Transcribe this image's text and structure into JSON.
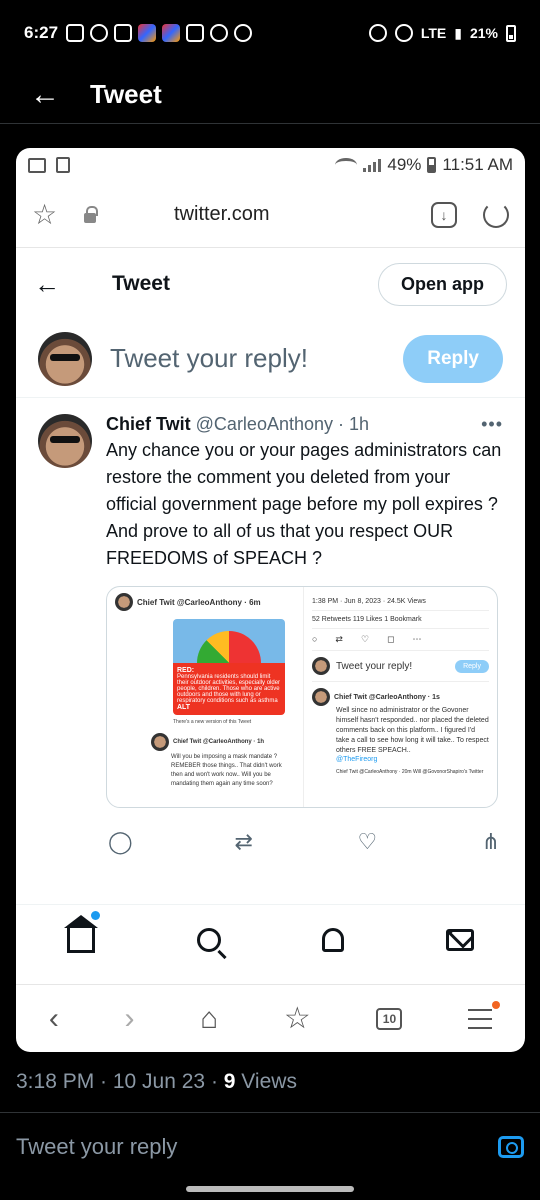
{
  "status_bar": {
    "time": "6:27",
    "battery": "21%",
    "network": "LTE"
  },
  "header": {
    "title": "Tweet"
  },
  "inner_status": {
    "battery": "49%",
    "time": "11:51 AM"
  },
  "browser": {
    "url": "twitter.com"
  },
  "twitter": {
    "title": "Tweet",
    "open_app": "Open app",
    "reply_placeholder": "Tweet your reply!",
    "reply_button": "Reply"
  },
  "tweet": {
    "name": "Chief Twit",
    "handle": "@CarleoAnthony · 1h",
    "more": "•••",
    "text": "Any chance you or your pages administrators can restore the comment you deleted from your official government page before my poll expires ?\nAnd prove to all of us that you respect OUR FREEDOMS of SPEACH ?"
  },
  "embed": {
    "left_head": "Chief Twit @CarleoAnthony · 6m",
    "alert_title": "RED:",
    "alert_body": "Pennsylvania residents should limit their outdoor activities, especially older people, children. Those who are active outdoors and those with lung or respiratory conditions such as asthma",
    "alt": "ALT",
    "new_version": "There's a new version of this Tweet",
    "reply_head": "Chief Twit @CarleoAnthony · 1h",
    "reply_text": "Will you be imposing a mask mandate ? REMEBER those things.. That didn't work then and won't work now.. Will you be mandating them again any time soon?",
    "meta": "1:38 PM · Jun 8, 2023 · 24.5K Views",
    "stats": "52 Retweets   119 Likes   1 Bookmark",
    "mini_reply": "Tweet your reply!",
    "mini_reply_btn": "Reply",
    "right_head": "Chief Twit @CarleoAnthony · 1s",
    "right_text": "Well since no administrator or the Govoner himself hasn't responded.. nor placed the deleted comments back on this platform.. I figured I'd take a call to see how long it will take.. To respect others FREE SPEACH..",
    "right_link": "@TheFireorg",
    "right_sub": "Chief Twit @CarleoAnthony · 20m Will @GovonorShapiro's Twitter"
  },
  "footer": {
    "time": "3:18 PM · 10 Jun 23 · ",
    "views_count": "9",
    "views_label": " Views",
    "reply_placeholder": "Tweet your reply"
  },
  "browser_tabs": "10"
}
